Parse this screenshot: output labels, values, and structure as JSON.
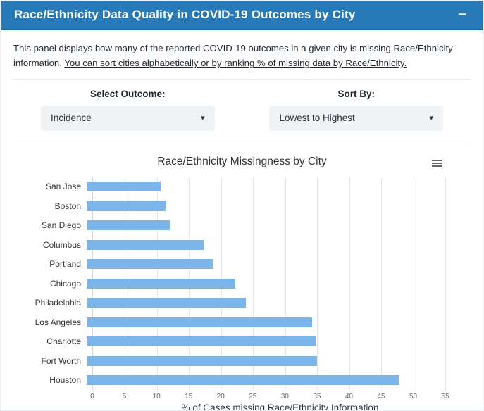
{
  "header": {
    "title": "Race/Ethnicity Data Quality in COVID-19 Outcomes by City",
    "collapse_label": "−"
  },
  "description": {
    "text_plain": "This panel displays how many of the reported COVID-19 outcomes in a given city is missing Race/Ethnicity information. ",
    "text_underlined": "You can sort cities alphabetically or by ranking % of missing data by Race/Ethnicity."
  },
  "controls": {
    "outcome": {
      "label": "Select Outcome:",
      "value": "Incidence"
    },
    "sort": {
      "label": "Sort By:",
      "value": "Lowest to Highest"
    }
  },
  "icons": {
    "dropdown_caret": "▾",
    "chart_menu": "hamburger-menu"
  },
  "chart_data": {
    "type": "bar",
    "orientation": "horizontal",
    "title": "Race/Ethnicity Missingness by City",
    "categories": [
      "San Jose",
      "Boston",
      "San Diego",
      "Columbus",
      "Portland",
      "Chicago",
      "Philadelphia",
      "Los Angeles",
      "Charlotte",
      "Fort Worth",
      "Houston"
    ],
    "values": [
      11.3,
      12.2,
      12.8,
      18.0,
      19.4,
      22.8,
      24.4,
      34.6,
      35.1,
      35.4,
      47.9
    ],
    "xlabel": "% of Cases missing Race/Ethnicity Information",
    "xlim": [
      0,
      58.5
    ],
    "xticks": [
      0,
      5,
      10,
      15,
      20,
      25,
      30,
      35,
      40,
      45,
      50,
      55
    ],
    "bar_color": "#7cb5ec",
    "grid": "vertical-only",
    "legend": "none"
  },
  "colors": {
    "header_bg": "#2779b7",
    "bar": "#7cb5ec",
    "dropdown_bg": "#f0f3f5"
  }
}
